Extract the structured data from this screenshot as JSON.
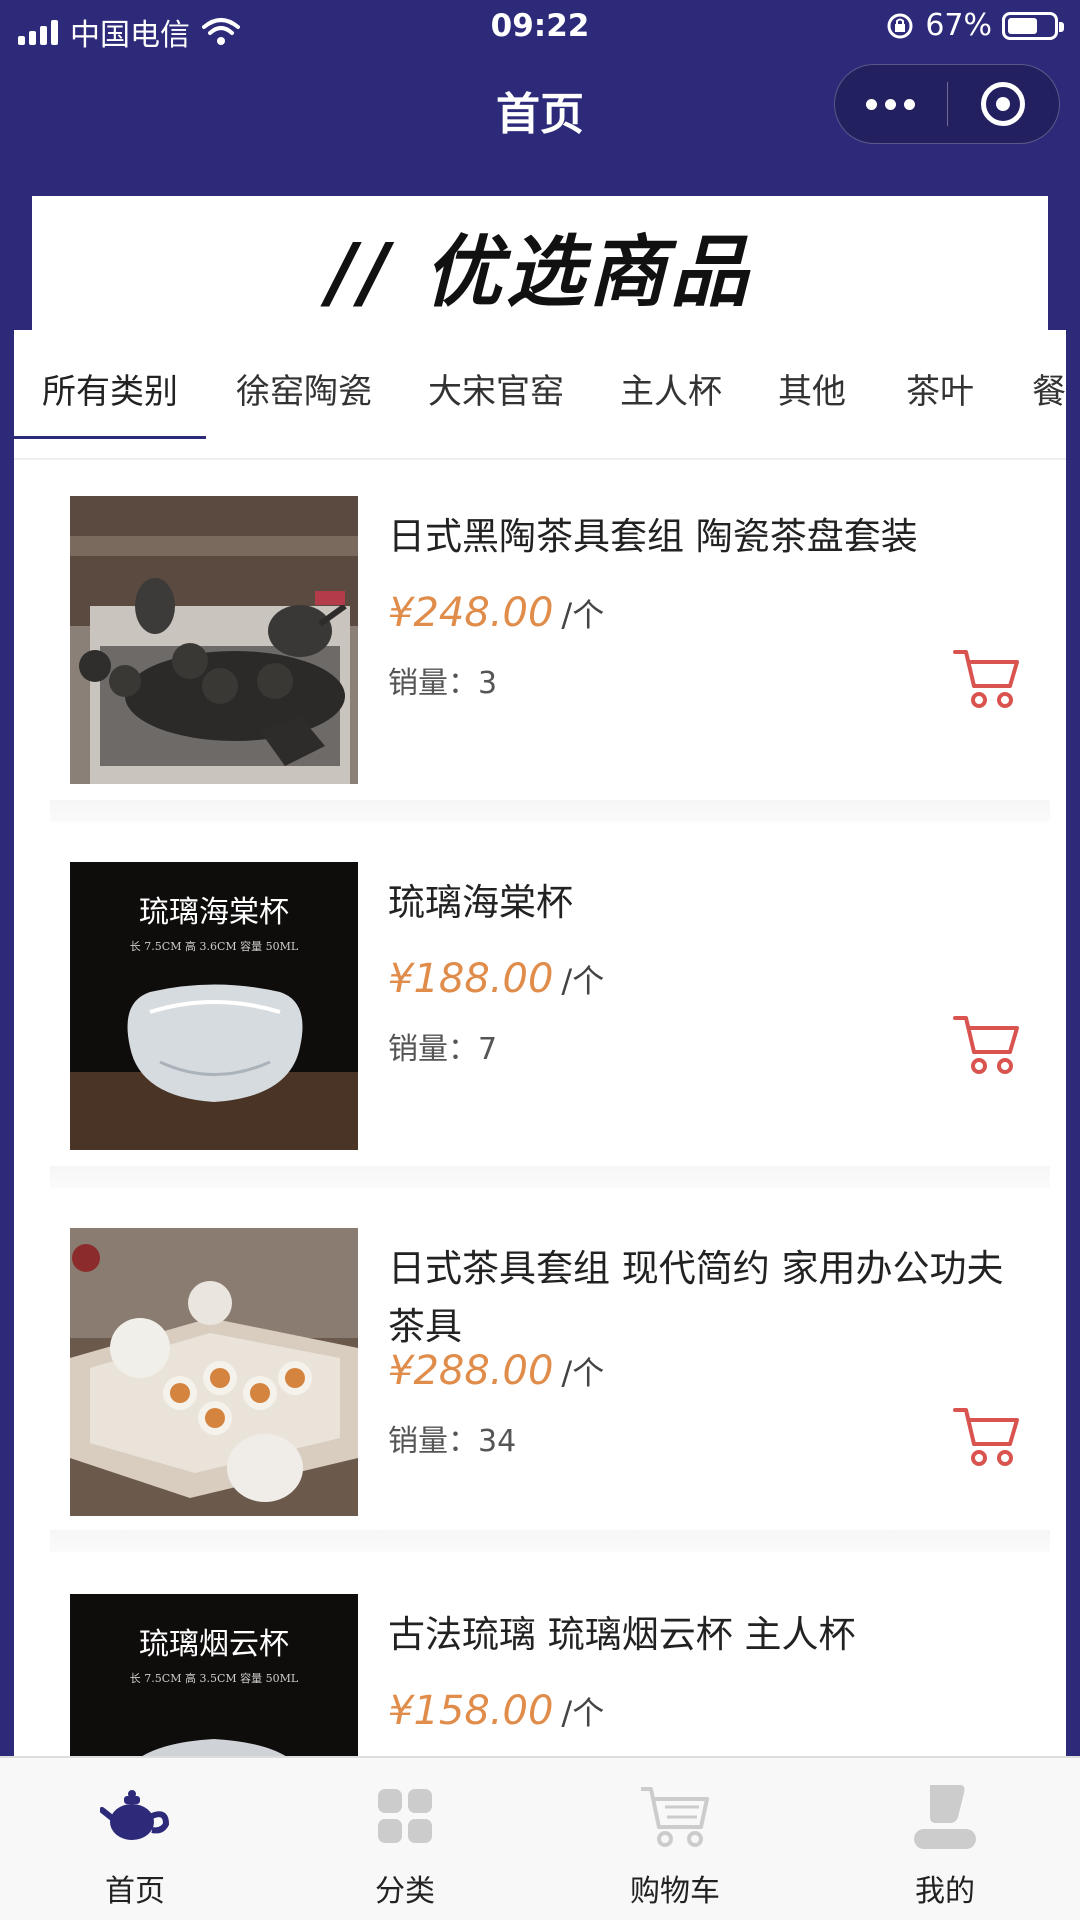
{
  "status_bar": {
    "carrier": "中国电信",
    "time": "09:22",
    "battery": "67%"
  },
  "nav": {
    "title": "首页"
  },
  "banner": {
    "title": "// 优选商品"
  },
  "category_tabs": [
    {
      "label": "所有类别",
      "active": true
    },
    {
      "label": "徐窑陶瓷",
      "active": false
    },
    {
      "label": "大宋官窑",
      "active": false
    },
    {
      "label": "主人杯",
      "active": false
    },
    {
      "label": "其他",
      "active": false
    },
    {
      "label": "茶叶",
      "active": false
    },
    {
      "label": "餐具",
      "active": false
    }
  ],
  "products": [
    {
      "name": "日式黑陶茶具套组 陶瓷茶盘套装",
      "price": "¥248.00",
      "unit": "/个",
      "sales": "销量：3",
      "image": "black-ceramic-tea-set"
    },
    {
      "name": "琉璃海棠杯",
      "price": "¥188.00",
      "unit": "/个",
      "sales": "销量：7",
      "image": "glass-haitang-cup",
      "image_text": {
        "title": "琉璃海棠杯",
        "spec": "长 7.5CM 高 3.6CM 容量 50ML"
      }
    },
    {
      "name": "日式茶具套组 现代简约 家用办公功夫茶具",
      "price": "¥288.00",
      "unit": "/个",
      "sales": "销量：34",
      "image": "white-tea-set-tray"
    },
    {
      "name": "古法琉璃 琉璃烟云杯 主人杯",
      "price": "¥158.00",
      "unit": "/个",
      "sales": "",
      "image": "glass-yanyun-cup",
      "image_text": {
        "title": "琉璃烟云杯",
        "spec": "长 7.5CM 高 3.5CM 容量 50ML"
      }
    }
  ],
  "tabbar": [
    {
      "label": "首页",
      "icon": "teapot-icon",
      "active": true
    },
    {
      "label": "分类",
      "icon": "grid-icon",
      "active": false
    },
    {
      "label": "购物车",
      "icon": "shopping-cart-icon",
      "active": false
    },
    {
      "label": "我的",
      "icon": "user-icon",
      "active": false
    }
  ],
  "colors": {
    "theme": "#2d2a7a",
    "price": "#e08c4a",
    "cart": "#d9534f",
    "tab_inactive_icon": "#cccccc"
  }
}
